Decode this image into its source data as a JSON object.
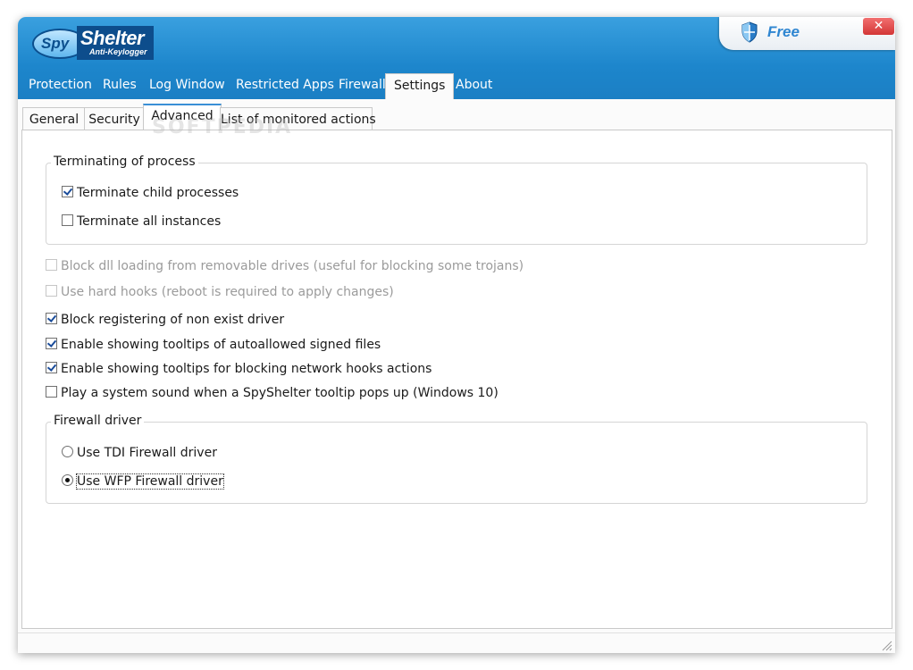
{
  "app": {
    "logo": {
      "spy": "Spy",
      "shelter": "Shelter",
      "tagline": "Anti-Keylogger"
    },
    "edition": "Free",
    "close_label": "✕"
  },
  "nav": {
    "items": [
      {
        "label": "Protection"
      },
      {
        "label": "Rules"
      },
      {
        "label": "Log Window"
      },
      {
        "label": "Restricted Apps"
      },
      {
        "label": "Firewall"
      },
      {
        "label": "Settings",
        "active": true
      },
      {
        "label": "About"
      }
    ]
  },
  "subtabs": {
    "items": [
      {
        "label": "General"
      },
      {
        "label": "Security"
      },
      {
        "label": "Advanced",
        "active": true
      },
      {
        "label": "List of monitored actions"
      }
    ]
  },
  "watermark": "SOFTPEDIA",
  "terminating": {
    "legend": "Terminating of process",
    "child": {
      "label": "Terminate child processes",
      "checked": true
    },
    "all": {
      "label": "Terminate all instances",
      "checked": false
    }
  },
  "options": [
    {
      "label": "Block dll loading from removable drives (useful for blocking some trojans)",
      "checked": false,
      "disabled": true
    },
    {
      "label": "Use hard hooks (reboot is required to apply changes)",
      "checked": false,
      "disabled": true
    },
    {
      "label": "Block registering of non exist driver",
      "checked": true,
      "disabled": false
    },
    {
      "label": "Enable showing tooltips of autoallowed signed files",
      "checked": true,
      "disabled": false
    },
    {
      "label": "Enable showing tooltips for blocking network hooks actions",
      "checked": true,
      "disabled": false
    },
    {
      "label": "Play a system sound when a SpyShelter tooltip pops up (Windows 10)",
      "checked": false,
      "disabled": false
    }
  ],
  "firewall": {
    "legend": "Firewall driver",
    "tdi": {
      "label": "Use TDI Firewall driver",
      "selected": false
    },
    "wfp": {
      "label": "Use WFP Firewall driver",
      "selected": true
    }
  },
  "colors": {
    "header": "#1d86cc",
    "accent": "#2f86d1",
    "close": "#d33636"
  }
}
